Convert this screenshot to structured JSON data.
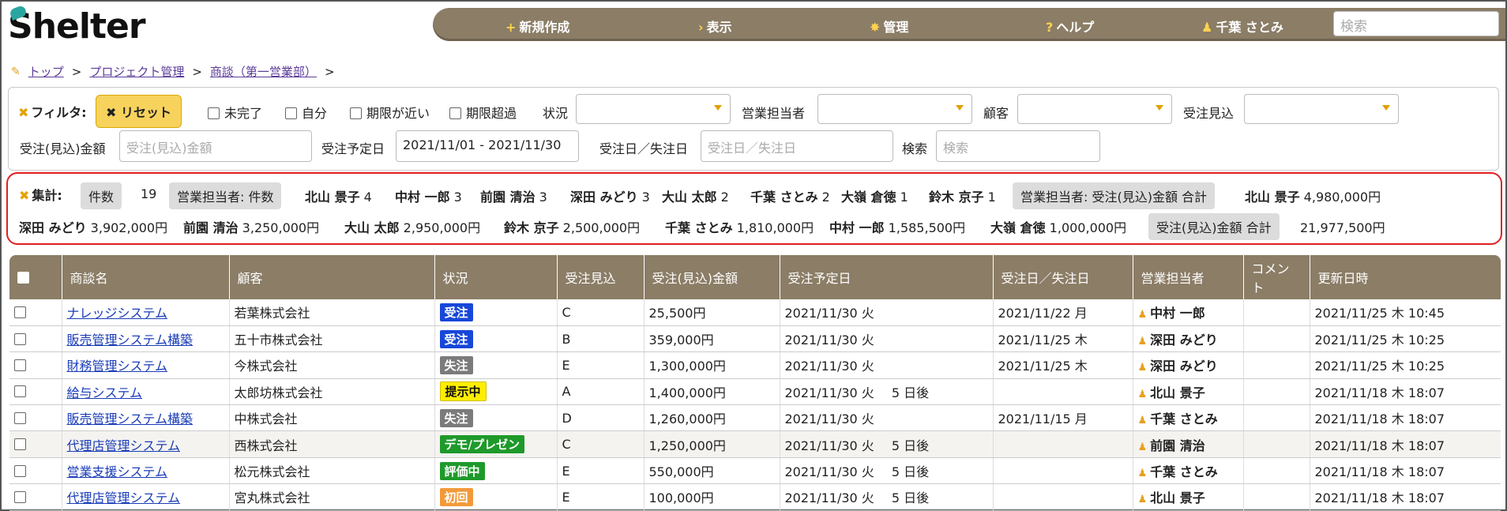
{
  "app": {
    "logo": "Shelter"
  },
  "nav": {
    "new": "新規作成",
    "view": "表示",
    "admin": "管理",
    "help": "ヘルプ",
    "user": "千葉 さとみ",
    "search_placeholder": "検索"
  },
  "breadcrumb": [
    "トップ",
    "プロジェクト管理",
    "商談（第一営業部）"
  ],
  "filter": {
    "title": "フィルタ:",
    "reset": "リセット",
    "checks": [
      "未完了",
      "自分",
      "期限が近い",
      "期限超過"
    ],
    "status_label": "状況",
    "rep_label": "営業担当者",
    "customer_label": "顧客",
    "forecast_label": "受注見込",
    "amount_label": "受注(見込)金額",
    "amount_placeholder": "受注(見込)金額",
    "planned_label": "受注予定日",
    "planned_value": "2021/11/01 - 2021/11/30",
    "order_date_label": "受注日／失注日",
    "order_date_placeholder": "受注日／失注日",
    "search_label": "検索",
    "search_placeholder": "検索"
  },
  "summary": {
    "title": "集計:",
    "count_tag": "件数",
    "count": "19",
    "rep_count_tag": "営業担当者: 件数",
    "rep_counts": [
      {
        "name": "北山 景子",
        "value": "4"
      },
      {
        "name": "中村 一郎",
        "value": "3"
      },
      {
        "name": "前園 清治",
        "value": "3"
      },
      {
        "name": "深田 みどり",
        "value": "3"
      },
      {
        "name": "大山 太郎",
        "value": "2"
      },
      {
        "name": "千葉 さとみ",
        "value": "2"
      },
      {
        "name": "大嶺 倉徳",
        "value": "1"
      },
      {
        "name": "鈴木 京子",
        "value": "1"
      }
    ],
    "rep_amount_tag": "営業担当者: 受注(見込)金額 合計",
    "rep_amounts": [
      {
        "name": "北山 景子",
        "value": "4,980,000円"
      },
      {
        "name": "深田 みどり",
        "value": "3,902,000円"
      },
      {
        "name": "前園 清治",
        "value": "3,250,000円"
      },
      {
        "name": "大山 太郎",
        "value": "2,950,000円"
      },
      {
        "name": "鈴木 京子",
        "value": "2,500,000円"
      },
      {
        "name": "千葉 さとみ",
        "value": "1,810,000円"
      },
      {
        "name": "中村 一郎",
        "value": "1,585,500円"
      },
      {
        "name": "大嶺 倉徳",
        "value": "1,000,000円"
      }
    ],
    "total_tag": "受注(見込)金額 合計",
    "total": "21,977,500円"
  },
  "table": {
    "headers": [
      "商談名",
      "顧客",
      "状況",
      "受注見込",
      "受注(見込)金額",
      "受注予定日",
      "受注日／失注日",
      "営業担当者",
      "コメント",
      "更新日時"
    ],
    "rows": [
      {
        "name": "ナレッジシステム",
        "customer": "若葉株式会社",
        "status": "受注",
        "status_color": "#1747d9",
        "forecast": "C",
        "amount": "25,500円",
        "planned": "2021/11/30 火",
        "remain": "",
        "order_date": "2021/11/22 月",
        "rep": "中村 一郎",
        "comment": "",
        "updated": "2021/11/25 木 10:45"
      },
      {
        "name": "販売管理システム構築",
        "customer": "五十市株式会社",
        "status": "受注",
        "status_color": "#1747d9",
        "forecast": "B",
        "amount": "359,000円",
        "planned": "2021/11/30 火",
        "remain": "",
        "order_date": "2021/11/25 木",
        "rep": "深田 みどり",
        "comment": "",
        "updated": "2021/11/25 木 10:25"
      },
      {
        "name": "財務管理システム",
        "customer": "今株式会社",
        "status": "失注",
        "status_color": "#7b7b7b",
        "forecast": "E",
        "amount": "1,300,000円",
        "planned": "2021/11/30 火",
        "remain": "",
        "order_date": "2021/11/25 木",
        "rep": "深田 みどり",
        "comment": "",
        "updated": "2021/11/25 木 10:25"
      },
      {
        "name": "給与システム",
        "customer": "太郎坊株式会社",
        "status": "提示中",
        "status_color": "#ffee00",
        "forecast": "A",
        "amount": "1,400,000円",
        "planned": "2021/11/30 火",
        "remain": "5 日後",
        "order_date": "",
        "rep": "北山 景子",
        "comment": "",
        "updated": "2021/11/18 木 18:07"
      },
      {
        "name": "販売管理システム構築",
        "customer": "中株式会社",
        "status": "失注",
        "status_color": "#7b7b7b",
        "forecast": "D",
        "amount": "1,260,000円",
        "planned": "2021/11/30 火",
        "remain": "",
        "order_date": "2021/11/15 月",
        "rep": "千葉 さとみ",
        "comment": "",
        "updated": "2021/11/18 木 18:07"
      },
      {
        "name": "代理店管理システム",
        "customer": "西株式会社",
        "status": "デモ/プレゼン",
        "status_color": "#1e9a2a",
        "forecast": "C",
        "amount": "1,250,000円",
        "planned": "2021/11/30 火",
        "remain": "5 日後",
        "order_date": "",
        "rep": "前園 清治",
        "comment": "",
        "updated": "2021/11/18 木 18:07"
      },
      {
        "name": "営業支援システム",
        "customer": "松元株式会社",
        "status": "評価中",
        "status_color": "#1e9a2a",
        "forecast": "E",
        "amount": "550,000円",
        "planned": "2021/11/30 火",
        "remain": "5 日後",
        "order_date": "",
        "rep": "千葉 さとみ",
        "comment": "",
        "updated": "2021/11/18 木 18:07"
      },
      {
        "name": "代理店管理システム",
        "customer": "宮丸株式会社",
        "status": "初回",
        "status_color": "#f29a3a",
        "forecast": "E",
        "amount": "100,000円",
        "planned": "2021/11/30 火",
        "remain": "5 日後",
        "order_date": "",
        "rep": "北山 景子",
        "comment": "",
        "updated": "2021/11/18 木 18:07"
      }
    ]
  }
}
